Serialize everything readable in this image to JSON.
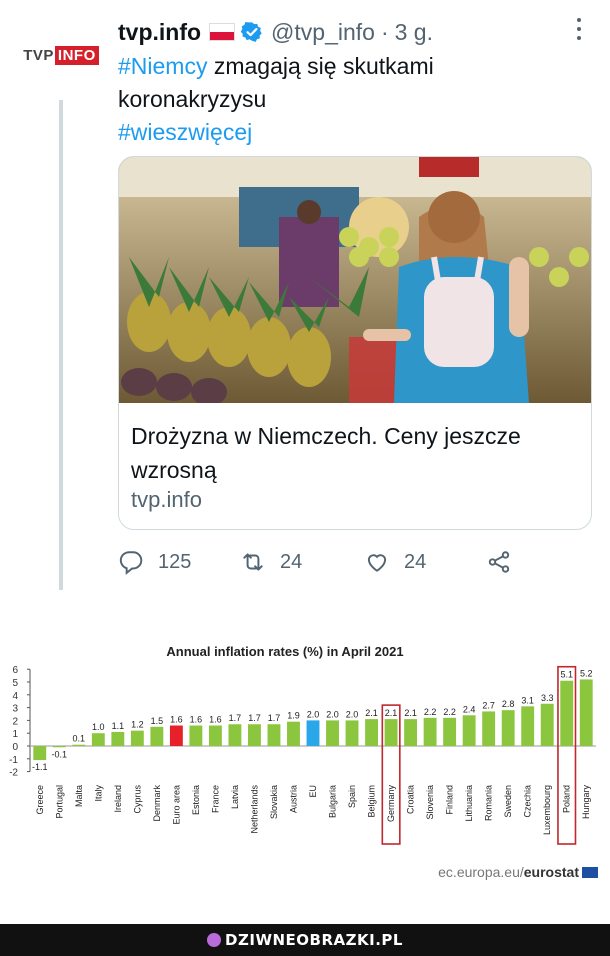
{
  "tweet": {
    "avatar_label_tvp": "TVP",
    "avatar_label_info": "INFO",
    "display_name": "tvp.info",
    "handle": "@tvp_info",
    "dot": "·",
    "time": "3 g.",
    "text": {
      "hashtag1": "#Niemcy",
      "line1": " zmagają się skutkami",
      "line2": "koronakryzysu",
      "hashtag2": "#wieszwięcej"
    },
    "card": {
      "title": "Drożyzna w Niemczech. Ceny jeszcze wzrosną",
      "domain": "tvp.info"
    },
    "actions": {
      "replies": "125",
      "retweets": "24",
      "likes": "24"
    }
  },
  "chart_data": {
    "type": "bar",
    "title": "Annual inflation rates (%) in April 2021",
    "categories": [
      "Greece",
      "Portugal",
      "Malta",
      "Italy",
      "Ireland",
      "Cyprus",
      "Denmark",
      "Euro area",
      "Estonia",
      "France",
      "Latvia",
      "Netherlands",
      "Slovakia",
      "Austria",
      "EU",
      "Bulgaria",
      "Spain",
      "Belgium",
      "Germany",
      "Croatia",
      "Slovenia",
      "Finland",
      "Lithuania",
      "Romania",
      "Sweden",
      "Czechia",
      "Luxembourg",
      "Poland",
      "Hungary"
    ],
    "values": [
      -1.1,
      -0.1,
      0.1,
      1.0,
      1.1,
      1.2,
      1.5,
      1.6,
      1.6,
      1.6,
      1.7,
      1.7,
      1.7,
      1.9,
      2.0,
      2.0,
      2.0,
      2.1,
      2.1,
      2.1,
      2.2,
      2.2,
      2.4,
      2.7,
      2.8,
      3.1,
      3.3,
      5.1,
      5.2
    ],
    "value_labels": [
      "-1.1",
      "-0.1",
      "0.1",
      "1.0",
      "1.1",
      "1.2",
      "1.5",
      "1.6",
      "1.6",
      "1.6",
      "1.7",
      "1.7",
      "1.7",
      "1.9",
      "2.0",
      "2.0",
      "2.0",
      "2.1",
      "2.1",
      "2.1",
      "2.2",
      "2.2",
      "2.4",
      "2.7",
      "2.8",
      "3.1",
      "3.3",
      "5.1",
      "5.2"
    ],
    "ylim": [
      -2,
      6
    ],
    "yticks": [
      "-2",
      "-1",
      "0",
      "1",
      "2",
      "3",
      "4",
      "5",
      "6"
    ],
    "highlighted": [
      "Germany",
      "Poland"
    ],
    "colors": {
      "default": "#8cc63f",
      "euro_area": "#e8202a",
      "eu": "#2aa7e8",
      "highlight_box": "#c0282d"
    },
    "source_prefix": "ec.europa.eu/",
    "source_brand": "eurostat"
  },
  "footer": {
    "brand": "DZIWNEOBRAZKI.PL"
  }
}
